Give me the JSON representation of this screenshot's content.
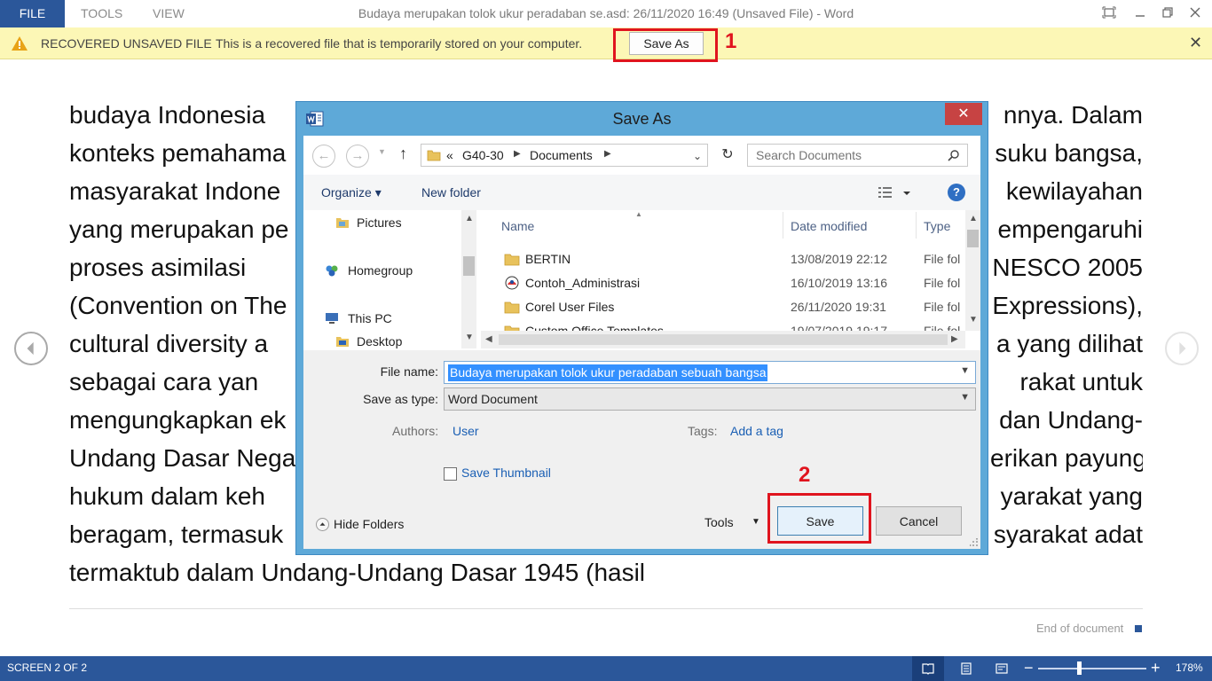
{
  "titlebar": {
    "file_tab": "FILE",
    "tools_tab": "TOOLS",
    "view_tab": "VIEW",
    "title": "Budaya merupakan tolok ukur peradaban se.asd: 26/11/2020 16:49 (Unsaved File) - Word"
  },
  "infobar": {
    "title": "RECOVERED UNSAVED FILE",
    "message": "This is a recovered file that is temporarily stored on your computer.",
    "save_as_label": "Save As",
    "close_glyph": "✕",
    "step1": "1"
  },
  "document": {
    "lines": [
      "budaya Indonesia",
      "konteks pemahama",
      "masyarakat Indone",
      "yang merupakan pe",
      "proses asimilasi",
      "(Convention on The",
      "cultural diversity a",
      "sebagai cara yan",
      "mengungkapkan ek",
      "Undang Dasar Nega",
      "hukum dalam keh",
      "beragam, termasuk",
      "termaktub dalam Undang-Undang Dasar 1945 (hasil"
    ],
    "right_fragments": [
      "nnya. Dalam",
      "suku bangsa,",
      "kewilayahan",
      "empengaruhi",
      "NESCO 2005",
      "Expressions),",
      "a yang dilihat",
      "rakat untuk",
      "dan Undang-",
      "erikan payung",
      "yarakat yang",
      "syarakat adat"
    ],
    "end_label": "End of document"
  },
  "statusbar": {
    "screen": "SCREEN 2 OF 2",
    "zoom_minus": "−",
    "zoom_plus": "+",
    "zoom": "178%",
    "zoom_fraction": 0.38
  },
  "dialog": {
    "title": "Save As",
    "close_glyph": "✕",
    "address": {
      "prefix": "«",
      "crumbs": [
        "G40-30",
        "Documents"
      ],
      "refresh_glyph": "↻"
    },
    "search_placeholder": "Search Documents",
    "toolbar": {
      "organize": "Organize ▾",
      "new_folder": "New folder",
      "help": "?"
    },
    "nav_items": [
      "Pictures",
      "Homegroup",
      "This PC",
      "Desktop"
    ],
    "columns": {
      "name": "Name",
      "date": "Date modified",
      "type": "Type"
    },
    "files": [
      {
        "name": "BERTIN",
        "date": "13/08/2019 22:12",
        "type": "File fol"
      },
      {
        "name": "Contoh_Administrasi",
        "date": "16/10/2019 13:16",
        "type": "File fol"
      },
      {
        "name": "Corel User Files",
        "date": "26/11/2020 19:31",
        "type": "File fol"
      },
      {
        "name": "Custom Office Templates",
        "date": "19/07/2019 19:17",
        "type": "File fol"
      }
    ],
    "file_name_label": "File name:",
    "file_name_value": "Budaya merupakan tolok ukur peradaban sebuah bangsa",
    "save_type_label": "Save as type:",
    "save_type_value": "Word Document",
    "authors_label": "Authors:",
    "authors_value": "User",
    "tags_label": "Tags:",
    "tags_value": "Add a tag",
    "thumbnail_label": "Save Thumbnail",
    "hide_folders": "Hide Folders",
    "tools": "Tools",
    "save": "Save",
    "cancel": "Cancel",
    "step2": "2"
  },
  "colors": {
    "word_blue": "#2b579a",
    "infobar": "#fcf7b6",
    "annotation_red": "#e0141e",
    "dialog_frame": "#5ea9d8"
  }
}
